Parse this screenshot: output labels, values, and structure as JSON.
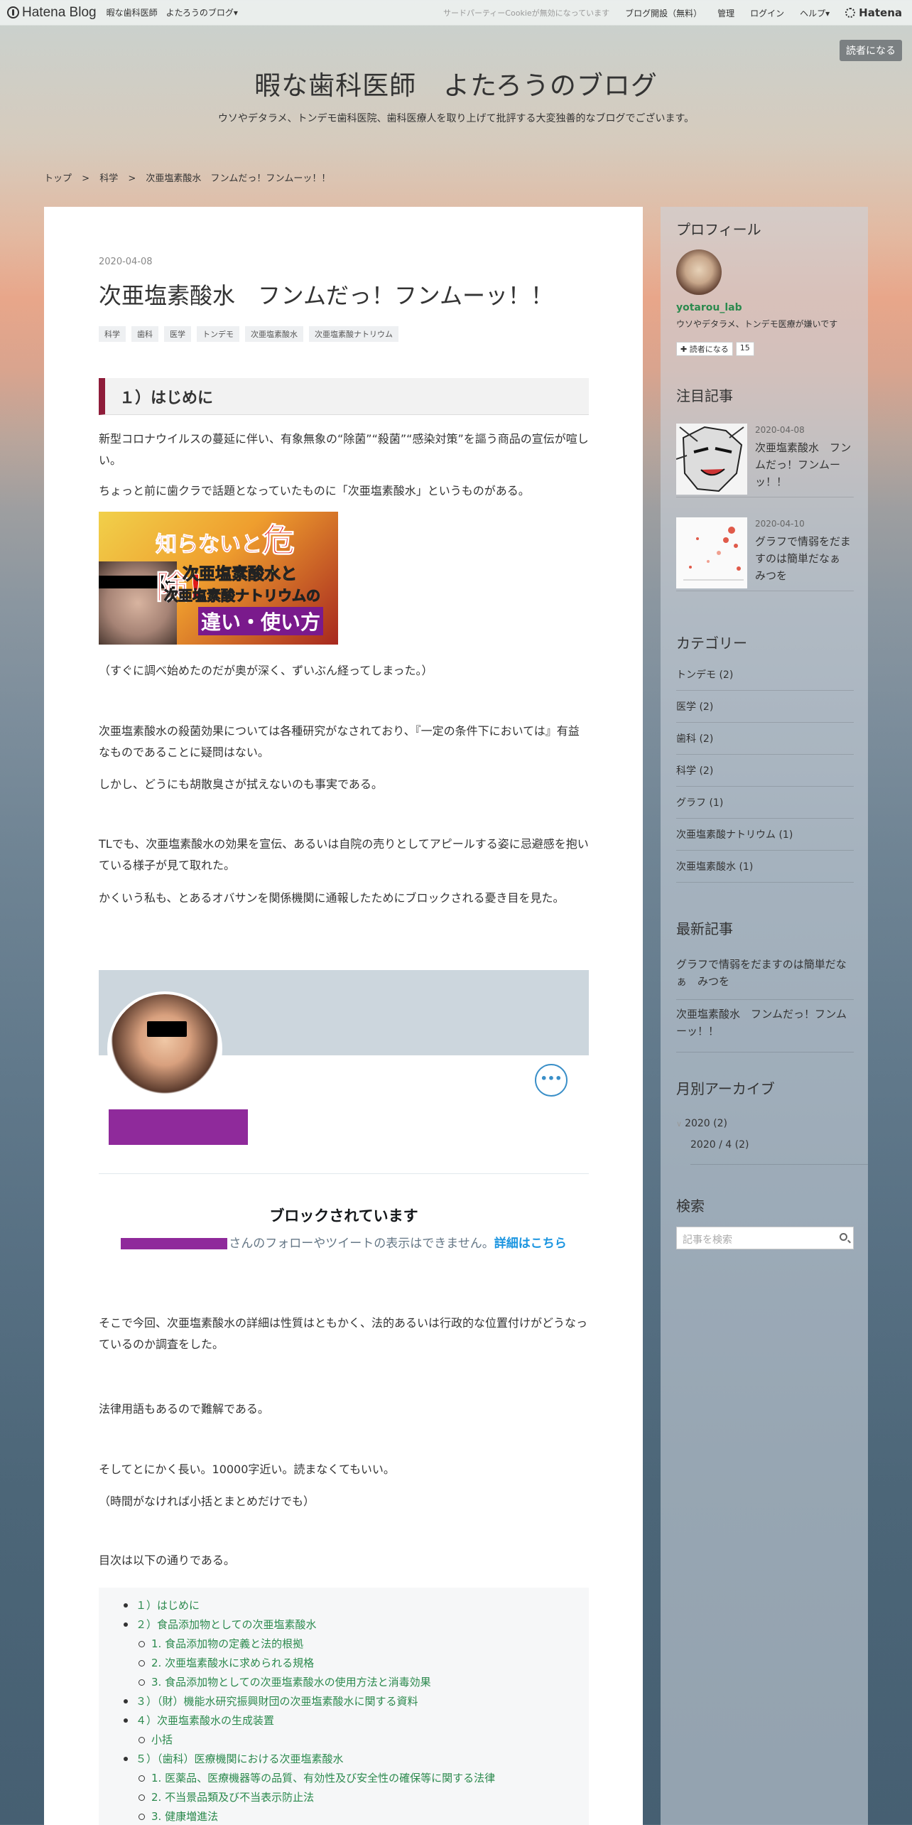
{
  "topbar": {
    "brand": "Hatena Blog",
    "blog_name": "暇な歯科医師",
    "blog_menu": "よたろうのブログ▾",
    "cookie_notice": "サードパーティーCookieが無効になっています",
    "start_blog": "ブログ開設（無料）",
    "admin": "管理",
    "login": "ログイン",
    "help": "ヘルプ▾",
    "hatena": "Hatena"
  },
  "follow_button": "読者になる",
  "blog": {
    "title": "暇な歯科医師　よたろうのブログ",
    "description": "ウソやデタラメ、トンデモ歯科医院、歯科医療人を取り上げて批評する大変独善的なブログでございます。"
  },
  "breadcrumb": [
    "トップ",
    ">",
    "科学",
    ">",
    "次亜塩素酸水　フンムだっ！フンムーッ！！"
  ],
  "entry": {
    "date": "2020-04-08",
    "title": "次亜塩素酸水　フンムだっ！フンムーッ！！",
    "categories": [
      "科学",
      "歯科",
      "医学",
      "トンデモ",
      "次亜塩素酸水",
      "次亜塩素酸ナトリウム"
    ],
    "section_heading": "１）はじめに",
    "paragraphs": [
      "新型コロナウイルスの蔓延に伴い、有象無象の“除菌”“殺菌”“感染対策”を謳う商品の宣伝が喧しい。",
      "ちょっと前に歯クラで話題となっていたものに「次亜塩素酸水」というものがある。",
      "（すぐに調べ始めたのだが奥が深く、ずいぶん経ってしまった。）",
      "次亜塩素酸水の殺菌効果については各種研究がなされており、『一定の条件下においては』有益なものであることに疑問はない。",
      "しかし、どうにも胡散臭さが拭えないのも事実である。",
      "TLでも、次亜塩素酸水の効果を宣伝、あるいは自院の売りとしてアピールする姿に忌避感を抱いている様子が見て取れた。",
      "かくいう私も、とあるオバサンを関係機関に通報したためにブロックされる憂き目を見た。",
      "そこで今回、次亜塩素酸水の詳細は性質はともかく、法的あるいは行政的な位置付けがどうなっているのか調査をした。",
      "法律用語もあるので難解である。",
      "そしてとにかく長い。10000字近い。読まなくてもいい。",
      "（時間がなければ小括とまとめだけでも）",
      "目次は以下の通りである。"
    ],
    "image_text": {
      "line1a": "知らないと",
      "line1b": "危険!",
      "line2": "次亜塩素酸水と",
      "line3": "次亜塩素酸ナトリウムの",
      "line4": "違い・使い方"
    },
    "twitter": {
      "more": "•••",
      "blocked_title": "ブロックされています",
      "blocked_desc": "さんのフォローやツイートの表示はできません。",
      "blocked_link": "詳細はこちら"
    },
    "toc": [
      {
        "level": 1,
        "text": "１）はじめに"
      },
      {
        "level": 1,
        "text": "２）食品添加物としての次亜塩素酸水"
      },
      {
        "level": 2,
        "text": "1. 食品添加物の定義と法的根拠"
      },
      {
        "level": 2,
        "text": "2. 次亜塩素酸水に求められる規格"
      },
      {
        "level": 2,
        "text": "3. 食品添加物としての次亜塩素酸水の使用方法と消毒効果"
      },
      {
        "level": 1,
        "text": "３）（財）機能水研究振興財団の次亜塩素酸水に関する資料"
      },
      {
        "level": 1,
        "text": "４）次亜塩素酸水の生成装置"
      },
      {
        "level": 2,
        "text": "小括"
      },
      {
        "level": 1,
        "text": "５）（歯科）医療機関における次亜塩素酸水"
      },
      {
        "level": 2,
        "text": "1. 医薬品、医療機器等の品質、有効性及び安全性の確保等に関する法律"
      },
      {
        "level": 2,
        "text": "2. 不当景品類及び不当表示防止法"
      },
      {
        "level": 2,
        "text": "3. 健康増進法"
      }
    ]
  },
  "sidebar": {
    "profile_heading": "プロフィール",
    "username": "yotarou_lab",
    "user_desc": "ウソやデタラメ、トンデモ医療が嫌いです",
    "reader_button": "✚ 読者になる",
    "reader_count": "15",
    "featured_heading": "注目記事",
    "featured": [
      {
        "date": "2020-04-08",
        "title": "次亜塩素酸水　フンムだっ！フンムーッ！！"
      },
      {
        "date": "2020-04-10",
        "title": "グラフで情弱をだますのは簡単だなぁ　みつを"
      }
    ],
    "category_heading": "カテゴリー",
    "categories": [
      "トンデモ (2)",
      "医学 (2)",
      "歯科 (2)",
      "科学 (2)",
      "グラフ (1)",
      "次亜塩素酸ナトリウム (1)",
      "次亜塩素酸水 (1)"
    ],
    "recent_heading": "最新記事",
    "recent": [
      "グラフで情弱をだますのは簡単だなぁ　みつを",
      "次亜塩素酸水　フンムだっ！フンムーッ！！"
    ],
    "archive_heading": "月別アーカイブ",
    "archive_year": "2020 (2)",
    "archive_month": "2020 / 4 (2)",
    "search_heading": "検索",
    "search_placeholder": "記事を検索"
  }
}
